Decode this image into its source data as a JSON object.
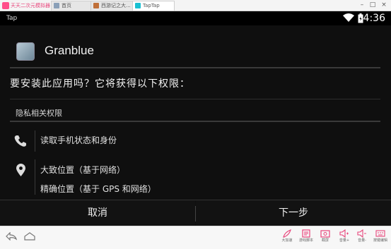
{
  "emulator": {
    "app_name": "天天二次元模拟器",
    "tabs": [
      {
        "label": "首页",
        "icon": "home-icon"
      },
      {
        "label": "西游记之大...",
        "icon": "game-icon"
      },
      {
        "label": "TapTap",
        "icon": "taptap-icon"
      }
    ],
    "window_controls": [
      "minimize-icon",
      "maximize-icon",
      "close-icon"
    ],
    "toolbar": [
      {
        "label": "大加速",
        "icon": "rocket-icon"
      },
      {
        "label": "游戏脚本",
        "icon": "script-icon"
      },
      {
        "label": "截屏",
        "icon": "screenshot-icon"
      },
      {
        "label": "音量+",
        "icon": "volume-up-icon"
      },
      {
        "label": "音量-",
        "icon": "volume-down-icon"
      },
      {
        "label": "按键编辑",
        "icon": "keyboard-icon"
      }
    ],
    "accent_color": "#e8467c"
  },
  "status_bar": {
    "app": "Tap",
    "time": "4:36"
  },
  "dialog": {
    "app_title": "Granblue",
    "question": "要安装此应用吗？它将获得以下权限：",
    "section": "隐私相关权限",
    "permissions": [
      {
        "icon": "phone-icon",
        "items": [
          "读取手机状态和身份"
        ]
      },
      {
        "icon": "location-icon",
        "items": [
          "大致位置（基于网络）",
          "精确位置（基于 GPS 和网络）"
        ]
      }
    ],
    "cancel": "取消",
    "next": "下一步"
  }
}
